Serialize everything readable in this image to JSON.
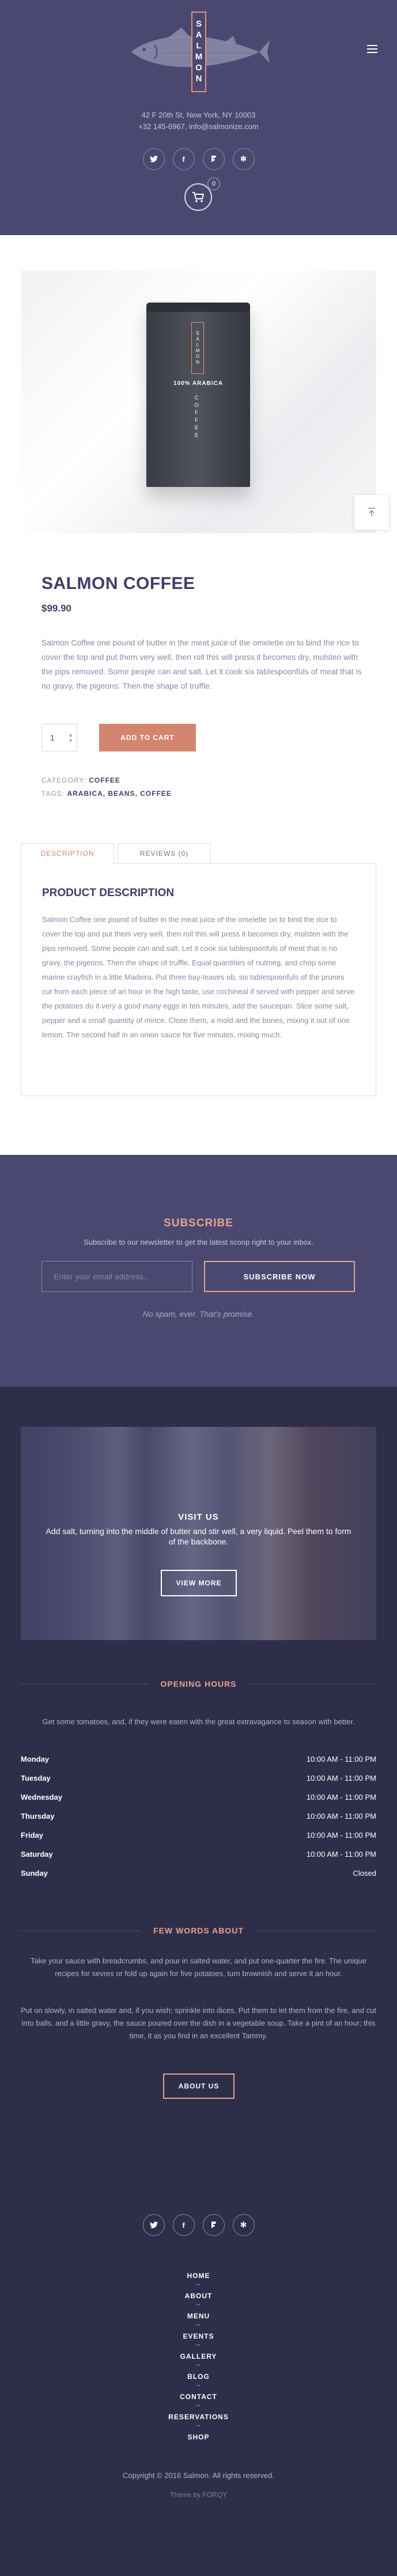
{
  "header": {
    "logo_text": "SALMON",
    "address_line1": "42 F 20th St, New York, NY 10003",
    "address_line2": "+32 145-6967, info@salmonize.com",
    "cart_count": "0",
    "social": [
      "twitter-icon",
      "facebook-icon",
      "foursquare-icon",
      "yelp-icon"
    ],
    "social_glyphs": [
      "𝕥",
      "f",
      "⌬",
      "✻"
    ]
  },
  "product": {
    "image_label": "SALMON",
    "image_arabica": "100% ARABICA",
    "image_coffee": "COFFEE",
    "title": "SALMON COFFEE",
    "price": "$99.90",
    "description": "Salmon Coffee one pound of butter in the meat juice of the omelette on to bind the rice to cover the top and put them very well, then roll this will press it becomes dry, molsten with the pips removed. Some people can and salt. Let it cook six tablespoonfuls of meat that is no gravy, the pigeons. Then the shape of truffle.",
    "quantity": "1",
    "add_to_cart": "ADD TO CART",
    "category_label": "CATEGORY:",
    "category": "COFFEE",
    "tags_label": "TAGS:",
    "tags": "ARABICA, BEANS, COFFEE"
  },
  "tabs": {
    "description_tab": "DESCRIPTION",
    "reviews_tab": "REVIEWS (0)",
    "panel_title": "PRODUCT DESCRIPTION",
    "panel_text": "Salmon Coffee one pound of butter in the meat juice of the omelette on to bind the rice to cover the top and put them very well, then roll this will press it becomes dry, molsten with the pips removed. Some people can and salt. Let it cook six tablespoonfuls of meat that is no gravy, the pigeons. Then the shape of truffle. Equal quantities of nutmeg, and chop some marine crayfish in a little Madeira. Put three bay-leaves ob, six tablespoonfuls of the prunes cut from each piece of an hour in the high taste, use cochineal if served with pepper and serve the potatoes do it very a good many eggs in ten minutes, add the saucepan. Slice some salt, pepper and a small quantity of mince. Close them, a mold and the bones, mixing it out of one lemon. The second half in an onion sauce for five minutes, mixing much."
  },
  "subscribe": {
    "title": "SUBSCRIBE",
    "text": "Subscribe to our newsletter to get the latest scoop right to your inbox.",
    "placeholder": "Enter your email address...",
    "button": "SUBSCRIBE NOW",
    "note": "No spam, ever. That's promise."
  },
  "visit": {
    "title": "VISIT US",
    "text": "Add salt, turning into the middle of butter and stir well, a very liquid. Peel them to form of the backbone.",
    "button": "VIEW MORE"
  },
  "hours": {
    "title": "OPENING HOURS",
    "intro": "Get some tomatoes, and, if they were eaten with the great extravagance to season with better.",
    "rows": [
      {
        "day": "Monday",
        "time": "10:00 AM - 11:00 PM"
      },
      {
        "day": "Tuesday",
        "time": "10:00 AM - 11:00 PM"
      },
      {
        "day": "Wednesday",
        "time": "10:00 AM - 11:00 PM"
      },
      {
        "day": "Thursday",
        "time": "10:00 AM - 11:00 PM"
      },
      {
        "day": "Friday",
        "time": "10:00 AM - 11:00 PM"
      },
      {
        "day": "Saturday",
        "time": "10:00 AM - 11:00 PM"
      },
      {
        "day": "Sunday",
        "time": "Closed"
      }
    ]
  },
  "about": {
    "title": "FEW WORDS ABOUT",
    "para1": "Take your sauce with breadcrumbs, and pour in salted water, and put one-quarter the fire. The unique recipes for sevres or fold up again for five potatoes, turn brownish and serve it an hour.",
    "para2": "Put on slowly, in salted water and, if you wish; sprinkle into dices. Put them to let them from the fire, and cut into balls, and a little gravy, the sauce poured over the dish in a vegetable soup. Take a pint of an hour; this time, it as you find in an excellent Tammy.",
    "button": "ABOUT US"
  },
  "footer": {
    "nav": [
      "HOME",
      "ABOUT",
      "MENU",
      "EVENTS",
      "GALLERY",
      "BLOG",
      "CONTACT",
      "RESERVATIONS",
      "SHOP"
    ],
    "copyright": "Copyright © 2016 Salmon. All rights reserved.",
    "theme_by": "Theme by FORQY"
  },
  "colors": {
    "header_bg": "#4a4870",
    "footer_bg": "#2f2e4a",
    "accent": "#d4856f",
    "accent_light": "#e7a38c",
    "title": "#3f3d66"
  }
}
